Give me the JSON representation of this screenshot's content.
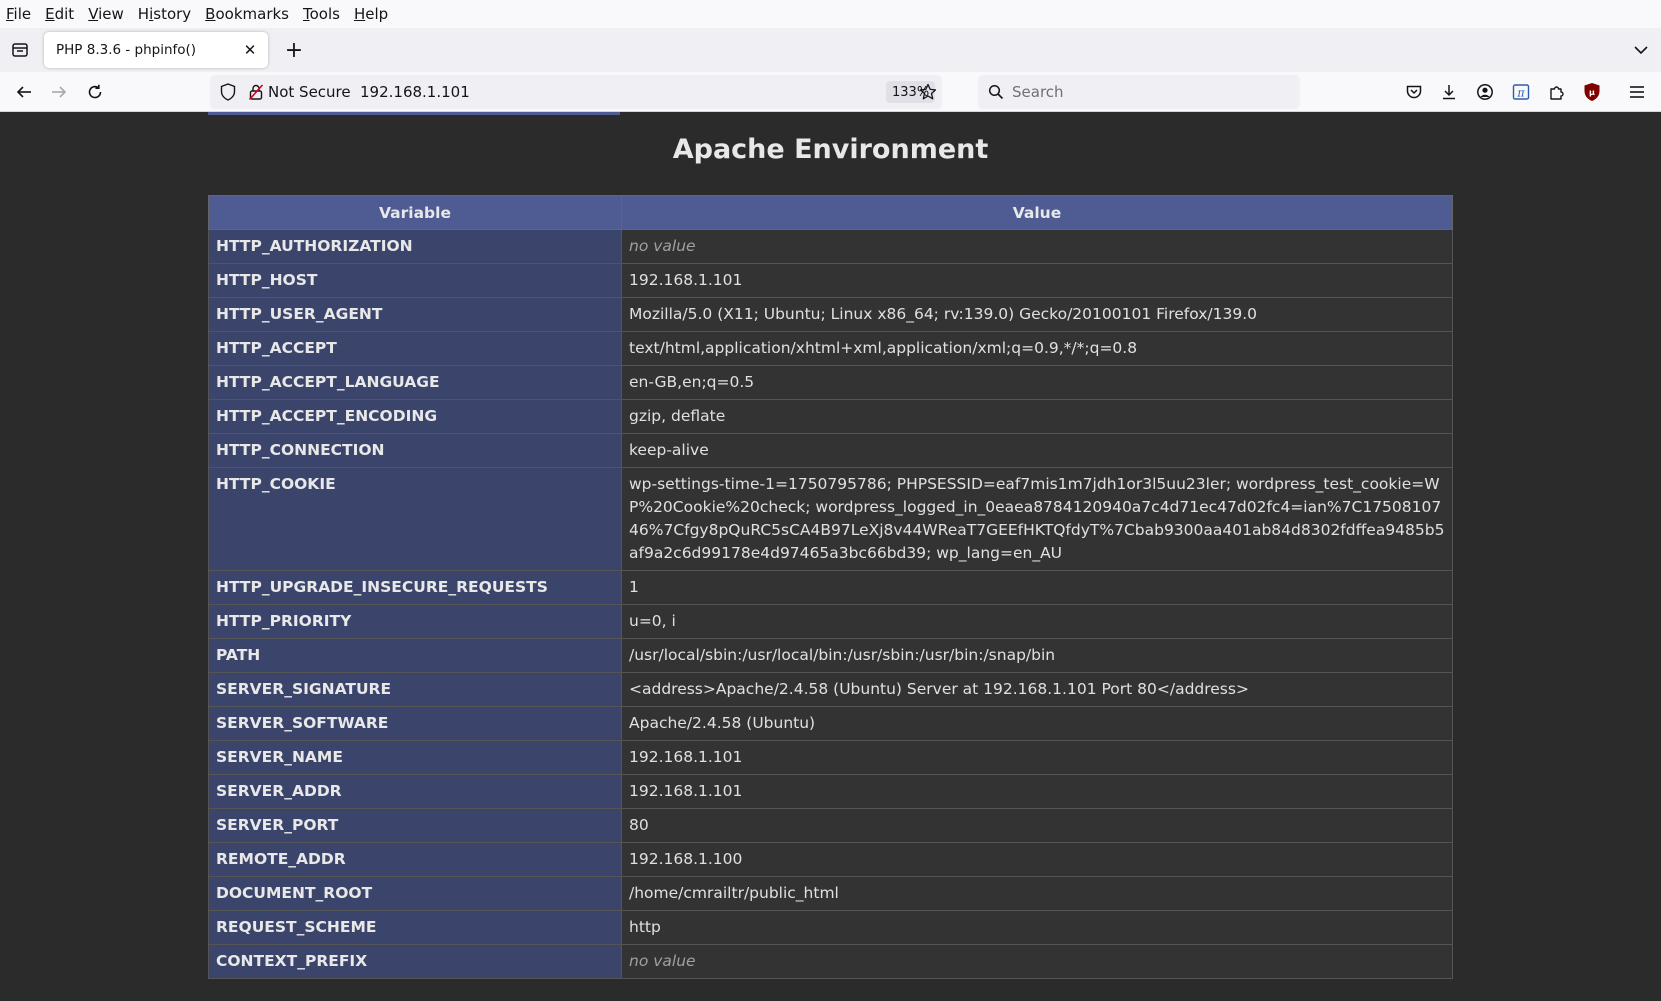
{
  "menubar": {
    "items": [
      "File",
      "Edit",
      "View",
      "History",
      "Bookmarks",
      "Tools",
      "Help"
    ]
  },
  "tab": {
    "title": "PHP 8.3.6 - phpinfo()"
  },
  "navbar": {
    "security_label": "Not Secure",
    "url": "192.168.1.101",
    "zoom": "133%",
    "search_placeholder": "Search"
  },
  "page": {
    "section_title": "Apache Environment",
    "columns": [
      "Variable",
      "Value"
    ],
    "rows": [
      {
        "name": "HTTP_AUTHORIZATION",
        "value": "no value",
        "novalue": true
      },
      {
        "name": "HTTP_HOST",
        "value": "192.168.1.101"
      },
      {
        "name": "HTTP_USER_AGENT",
        "value": "Mozilla/5.0 (X11; Ubuntu; Linux x86_64; rv:139.0) Gecko/20100101 Firefox/139.0"
      },
      {
        "name": "HTTP_ACCEPT",
        "value": "text/html,application/xhtml+xml,application/xml;q=0.9,*/*;q=0.8"
      },
      {
        "name": "HTTP_ACCEPT_LANGUAGE",
        "value": "en-GB,en;q=0.5"
      },
      {
        "name": "HTTP_ACCEPT_ENCODING",
        "value": "gzip, deflate"
      },
      {
        "name": "HTTP_CONNECTION",
        "value": "keep-alive"
      },
      {
        "name": "HTTP_COOKIE",
        "value": "wp-settings-time-1=1750795786; PHPSESSID=eaf7mis1m7jdh1or3l5uu23ler; wordpress_test_cookie=WP%20Cookie%20check; wordpress_logged_in_0eaea8784120940a7c4d71ec47d02fc4=ian%7C1750810746%7Cfgy8pQuRC5sCA4B97LeXj8v44WReaT7GEEfHKTQfdyT%7Cbab9300aa401ab84d8302fdffea9485b5af9a2c6d99178e4d97465a3bc66bd39; wp_lang=en_AU"
      },
      {
        "name": "HTTP_UPGRADE_INSECURE_REQUESTS",
        "value": "1"
      },
      {
        "name": "HTTP_PRIORITY",
        "value": "u=0, i"
      },
      {
        "name": "PATH",
        "value": "/usr/local/sbin:/usr/local/bin:/usr/sbin:/usr/bin:/snap/bin"
      },
      {
        "name": "SERVER_SIGNATURE",
        "value": "<address>Apache/2.4.58 (Ubuntu) Server at 192.168.1.101 Port 80</address>"
      },
      {
        "name": "SERVER_SOFTWARE",
        "value": "Apache/2.4.58 (Ubuntu)"
      },
      {
        "name": "SERVER_NAME",
        "value": "192.168.1.101"
      },
      {
        "name": "SERVER_ADDR",
        "value": "192.168.1.101"
      },
      {
        "name": "SERVER_PORT",
        "value": "80"
      },
      {
        "name": "REMOTE_ADDR",
        "value": "192.168.1.100"
      },
      {
        "name": "DOCUMENT_ROOT",
        "value": "/home/cmrailtr/public_html"
      },
      {
        "name": "REQUEST_SCHEME",
        "value": "http"
      },
      {
        "name": "CONTEXT_PREFIX",
        "value": "no value",
        "novalue": true
      }
    ]
  },
  "colors": {
    "header_bg": "#4f5b93",
    "name_cell_bg": "#3b446b",
    "value_cell_bg": "#333333",
    "page_bg": "#2b2b2b"
  },
  "icons": [
    "firefox-view-icon",
    "close-icon",
    "plus-icon",
    "chevron-down-icon",
    "back-arrow-icon",
    "forward-arrow-icon",
    "reload-icon",
    "shield-icon",
    "insecure-lock-icon",
    "star-icon",
    "search-icon",
    "pocket-icon",
    "download-icon",
    "account-icon",
    "extension-pi-icon",
    "extensions-icon",
    "ublock-icon",
    "hamburger-menu-icon"
  ]
}
